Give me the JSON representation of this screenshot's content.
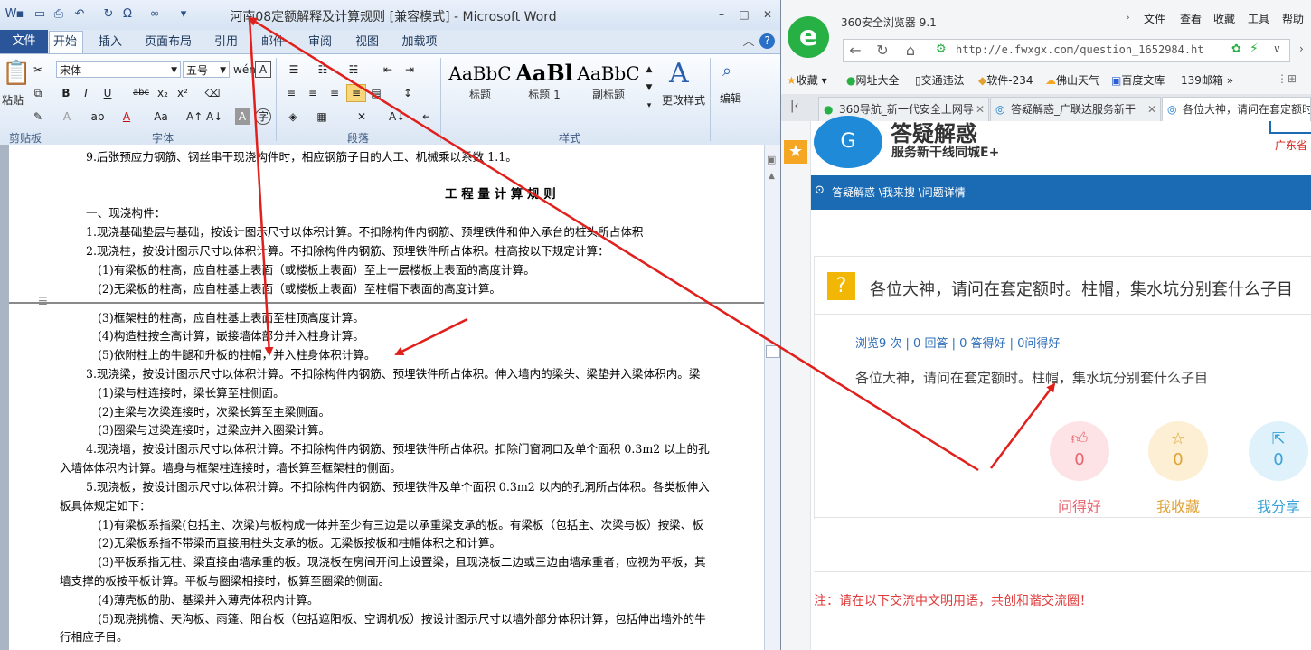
{
  "word": {
    "title": "河南08定额解释及计算规则 [兼容模式] - Microsoft Word",
    "window_controls": [
      "–",
      "□",
      "✕"
    ],
    "tabs": [
      "文件",
      "开始",
      "插入",
      "页面布局",
      "引用",
      "邮件",
      "审阅",
      "视图",
      "加载项"
    ],
    "font_name": "宋体",
    "font_size": "五号",
    "groups": {
      "clipboard": "剪贴板",
      "font": "字体",
      "paragraph": "段落",
      "styles": "样式"
    },
    "paste_label": "粘贴",
    "styles": [
      {
        "sample": "AaBbC",
        "name": "标题"
      },
      {
        "sample": "AaBl",
        "name": "标题 1"
      },
      {
        "sample": "AaBbC",
        "name": "副标题"
      }
    ],
    "change_styles": "更改样式",
    "edit": "编辑",
    "document_lines": [
      "9.后张预应力钢筋、钢丝串干现浇构件时，相应钢筋子目的人工、机械乘以系数 1.1。",
      "工 程 量 计 算 规 则",
      "一、现浇构件：",
      "1.现浇基础垫层与基础，按设计图示尺寸以体积计算。不扣除构件内钢筋、预埋铁件和伸入承台的桩头所占体积",
      "2.现浇柱，按设计图示尺寸以体积计算。不扣除构件内钢筋、预埋铁件所占体积。柱高按以下规定计算：",
      "(1)有梁板的柱高，应自柱基上表面（或楼板上表面）至上一层楼板上表面的高度计算。",
      "(2)无梁板的柱高，应自柱基上表面（或楼板上表面）至柱帽下表面的高度计算。",
      "(3)框架柱的柱高，应自柱基上表面至柱顶高度计算。",
      "(4)构造柱按全高计算，嵌接墙体部分并入柱身计算。",
      "(5)依附柱上的牛腿和升板的柱帽，并入柱身体积计算。",
      "3.现浇梁，按设计图示尺寸以体积计算。不扣除构件内钢筋、预埋铁件所占体积。伸入墙内的梁头、梁垫并入梁体积内。梁",
      "(1)梁与柱连接时，梁长算至柱侧面。",
      "(2)主梁与次梁连接时，次梁长算至主梁侧面。",
      "(3)圈梁与过梁连接时，过梁应并入圈梁计算。",
      "4.现浇墙，按设计图示尺寸以体积计算。不扣除构件内钢筋、预埋铁件所占体积。扣除门窗洞口及单个面积 0.3m2 以上的孔",
      "入墙体体积内计算。墙身与框架柱连接时，墙长算至框架柱的侧面。",
      "5.现浇板，按设计图示尺寸以体积计算。不扣除构件内钢筋、预埋铁件及单个面积 0.3m2 以内的孔洞所占体积。各类板伸入",
      "板具体规定如下：",
      "(1)有梁板系指梁(包括主、次梁)与板构成一体并至少有三边是以承重梁支承的板。有梁板（包括主、次梁与板）按梁、板",
      "(2)无梁板系指不带梁而直接用柱头支承的板。无梁板按板和柱帽体积之和计算。",
      "(3)平板系指无柱、梁直接由墙承重的板。现浇板在房间开间上设置梁，且现浇板二边或三边由墙承重者，应视为平板，其",
      "墙支撑的板按平板计算。平板与圈梁相接时，板算至圈梁的侧面。",
      "(4)薄壳板的肋、基梁并入薄壳体积内计算。",
      "(5)现浇挑檐、天沟板、雨篷、阳台板（包括遮阳板、空调机板）按设计图示尺寸以墙外部分体积计算，包括伸出墙外的牛",
      "行相应子目。"
    ]
  },
  "browser": {
    "title": "360安全浏览器 9.1",
    "menu": [
      "文件",
      "查看",
      "收藏",
      "工具",
      "帮助"
    ],
    "url": "http://e.fwxgx.com/question_1652984.ht",
    "bookmarks": [
      "收藏",
      "网址大全",
      "交通违法",
      "软件-234",
      "佛山天气",
      "百度文库",
      "139邮箱"
    ],
    "tabs": [
      "360导航_新一代安全上网导",
      "答疑解惑_广联达服务新干",
      "各位大神，请问在套定额时"
    ],
    "site": {
      "name": "答疑解惑",
      "slogan": "服务新干线同城E+",
      "region": "广东省",
      "breadcrumb": "答疑解惑 \\我来搜 \\问题详情"
    },
    "question": {
      "title": "各位大神，请问在套定额时。柱帽，集水坑分别套什么子目",
      "stats": "浏览9 次 | 0 回答 | 0 答得好 | 0问得好",
      "body": "各位大神，请问在套定额时。柱帽，集水坑分别套什么子目",
      "actions": [
        {
          "label": "问得好",
          "count": "0",
          "color": "#e8636e",
          "bg": "#fde3e5",
          "icon": "thumb-up-icon"
        },
        {
          "label": "我收藏",
          "count": "0",
          "color": "#e0a234",
          "bg": "#fcefd4",
          "icon": "star-icon"
        },
        {
          "label": "我分享",
          "count": "0",
          "color": "#3aa3d8",
          "bg": "#dff1fb",
          "icon": "share-icon"
        }
      ]
    },
    "notice": "注：请在以下交流中文明用语，共创和谐交流圈！"
  },
  "annotation_color": "#e0201c"
}
